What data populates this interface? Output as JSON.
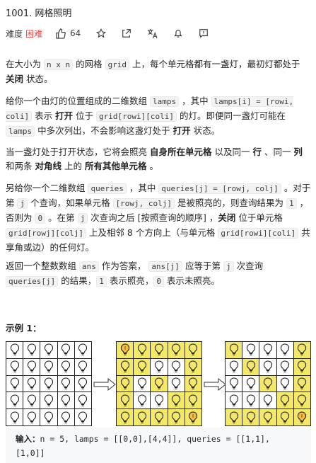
{
  "problem": {
    "title": "1001. 网格照明",
    "difficulty_label": "难度",
    "difficulty": "困难",
    "likes": "64"
  },
  "para1": {
    "t1": "在大小为 ",
    "c1": "n x n",
    "t2": " 的网格 ",
    "c2": "grid",
    "t3": " 上，每个单元格都有一盏灯，最初灯都处于 ",
    "b1": "关闭",
    "t4": " 状态。"
  },
  "para2": {
    "t1": "给你一个由灯的位置组成的二维数组 ",
    "c1": "lamps",
    "t2": " ，其中 ",
    "c2": "lamps[i] = [rowi, coli]",
    "t3": " 表示 ",
    "b1": "打开",
    "t4": " 位于 ",
    "c3": "grid[rowi][coli]",
    "t5": " 的灯。即便同一盏灯可能在 ",
    "c4": "lamps",
    "t6": " 中多次列出，不会影响这盏灯处于 ",
    "b2": "打开",
    "t7": " 状态。"
  },
  "para3": {
    "t1": "当一盏灯处于打开状态，它将会照亮 ",
    "b1": "自身所在单元格",
    "t2": " 以及同一 ",
    "b2": "行",
    "t3": " 、同一 ",
    "b3": "列",
    "t4": " 和两条 ",
    "b4": "对角线",
    "t5": " 上的 ",
    "b5": "所有其他单元格",
    "t6": " 。"
  },
  "para4": {
    "t1": "另给你一个二维数组 ",
    "c1": "queries",
    "t2": " ，其中 ",
    "c2": "queries[j] = [rowj, colj]",
    "t3": " 。对于第 ",
    "c3": "j",
    "t4": " 个查询，如果单元格 ",
    "c4": "[rowj, colj]",
    "t5": " 是被照亮的，则查询结果为 ",
    "c5": "1",
    "t6": " ，否则为 ",
    "c6": "0",
    "t7": " 。在第 ",
    "c7": "j",
    "t8": " 次查询之后 [按照查询的顺序] ，",
    "b1": "关闭",
    "t9": " 位于单元格 ",
    "c8": "grid[rowj][colj]",
    "t10": " 上及相邻 8 个方向上（与单元格 ",
    "c9": "grid[rowi][coli]",
    "t11": " 共享角或边）的任何灯。"
  },
  "para5": {
    "t1": "返回一个整数数组 ",
    "c1": "ans",
    "t2": " 作为答案， ",
    "c2": "ans[j]",
    "t3": " 应等于第 ",
    "c3": "j",
    "t4": " 次查询 ",
    "c4": "queries[j]",
    "t5": " 的结果，",
    "c5": "1",
    "t6": " 表示照亮，",
    "c6": "0",
    "t7": " 表示未照亮。"
  },
  "example": {
    "title": "示例 1：",
    "input_label": "输入：",
    "input_value": "n = 5, lamps = [[0,0],[4,4]], queries = [[1,1],",
    "input_value2": "[1,0]]"
  },
  "colors": {
    "lit": "#f4e967",
    "hard": "#ef4743"
  },
  "icons": [
    "thumbs-up-icon",
    "star-icon",
    "share-icon",
    "translate-icon",
    "bell-icon",
    "feedback-icon",
    "bulb-icon",
    "arrow-right-icon"
  ]
}
